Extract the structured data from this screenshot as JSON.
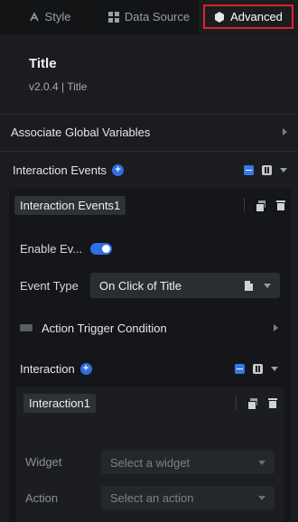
{
  "tabs": [
    {
      "label": "Style",
      "icon": "style-icon"
    },
    {
      "label": "Data Source",
      "icon": "data-source-icon"
    },
    {
      "label": "Advanced",
      "icon": "advanced-icon",
      "active": true
    }
  ],
  "header": {
    "title": "Title",
    "version": "v2.0.4 | Title"
  },
  "global_vars": {
    "label": "Associate Global Variables"
  },
  "interaction_events": {
    "label": "Interaction Events",
    "item": {
      "name": "Interaction Events1",
      "enable_label": "Enable Ev...",
      "enabled": true,
      "event_type_label": "Event Type",
      "event_type_value": "On Click of Title",
      "action_trigger_label": "Action Trigger Condition",
      "interaction": {
        "label": "Interaction",
        "item": {
          "name": "Interaction1",
          "widget_label": "Widget",
          "widget_placeholder": "Select a widget",
          "action_label": "Action",
          "action_placeholder": "Select an action"
        }
      }
    }
  },
  "colors": {
    "accent": "#2f6fe0",
    "highlight_border": "#e0202a",
    "background": "#1a1c1f"
  }
}
